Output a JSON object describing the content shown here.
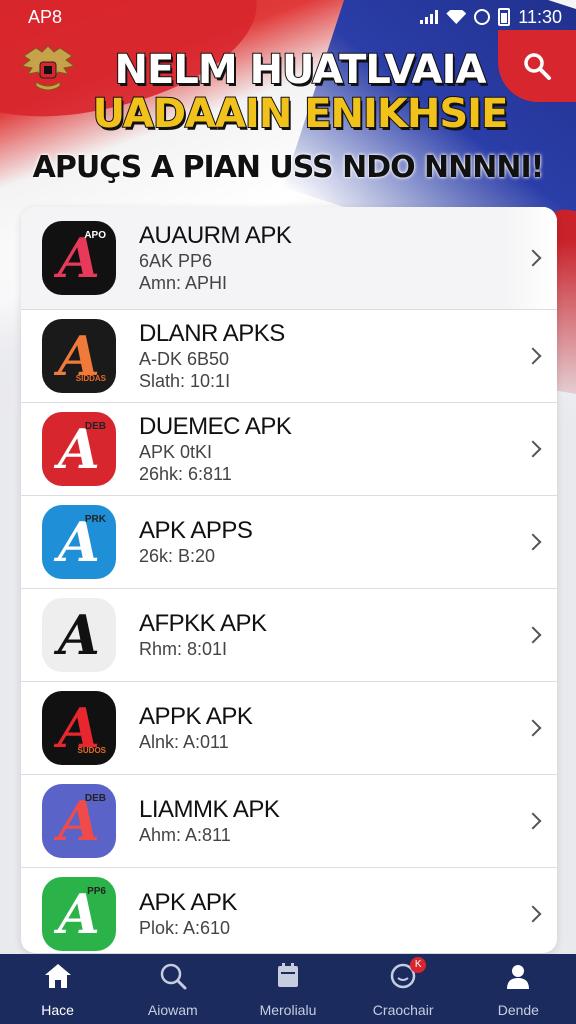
{
  "status_bar": {
    "left_text": "AP8",
    "time": "11:30"
  },
  "header": {
    "title_line1": "NELM HUATLVAIA",
    "title_line2": "UADAAIN ENIKHSIE",
    "subtitle": "APUÇS A PIAN USS NDO NNNNI!"
  },
  "apps": [
    {
      "name": "AUAURM APK",
      "line1": "6AK PP6",
      "line2": "Amn: APHI",
      "icon_bg": "#111111",
      "glyph_color": "#e8395a",
      "tiny": "APO",
      "tinyb": ""
    },
    {
      "name": "DLANR APKS",
      "line1": "A-DK 6B50",
      "line2": "Slath: 10:1I",
      "icon_bg": "#1a1a1a",
      "glyph_color": "#f07a3a",
      "tiny": "",
      "tinyb": "SIDDAS"
    },
    {
      "name": "DUEMEC APK",
      "line1": "APK 0tKI",
      "line2": "26hk: 6:811",
      "icon_bg": "#d7262e",
      "glyph_color": "#ffffff",
      "tiny": "DEB",
      "tinyb": ""
    },
    {
      "name": "APK  APPS",
      "line1": "26k: B:20",
      "line2": "",
      "icon_bg": "#1f8fd8",
      "glyph_color": "#ffffff",
      "tiny": "PRK",
      "tinyb": ""
    },
    {
      "name": "AFPKK APK",
      "line1": "Rhm: 8:01I",
      "line2": "",
      "icon_bg": "#eeeeee",
      "glyph_color": "#111111",
      "tiny": "",
      "tinyb": ""
    },
    {
      "name": "APPK APK",
      "line1": "Alnk: A:011",
      "line2": "",
      "icon_bg": "#111111",
      "glyph_color": "#e8262e",
      "tiny": "",
      "tinyb": "SUDOS"
    },
    {
      "name": "LIAMMK APK",
      "line1": "Ahm: A:811",
      "line2": "",
      "icon_bg": "#5a63c8",
      "glyph_color": "#f04a4a",
      "tiny": "DEB",
      "tinyb": ""
    },
    {
      "name": "APK  APK",
      "line1": "Plok: A:610",
      "line2": "",
      "icon_bg": "#2bb34a",
      "glyph_color": "#ffffff",
      "tiny": "PP6",
      "tinyb": ""
    }
  ],
  "bottom_nav": [
    {
      "label": "Hace",
      "icon": "home-icon",
      "active": true
    },
    {
      "label": "Aiowam",
      "icon": "search-icon",
      "active": false
    },
    {
      "label": "Merolialu",
      "icon": "folder-icon",
      "active": false
    },
    {
      "label": "Craochair",
      "icon": "chat-icon",
      "active": false,
      "badge": "K"
    },
    {
      "label": "Dende",
      "icon": "profile-icon",
      "active": false
    }
  ]
}
